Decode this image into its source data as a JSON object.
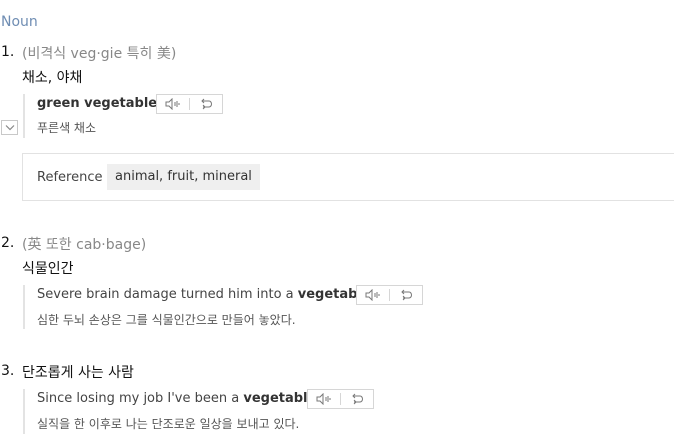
{
  "part_of_speech": "Noun",
  "senses": [
    {
      "number": "1.",
      "note": "(비격식 veg·gie 특히 美)",
      "meaning": "채소, 야채",
      "example": {
        "pre": "",
        "bold": "green vegetables",
        "post": "",
        "translation": "푸른색 채소"
      },
      "reference": {
        "label": "Reference",
        "items": "animal, fruit, mineral"
      }
    },
    {
      "number": "2.",
      "note": "(英 또한 cab·bage)",
      "meaning": "식물인간",
      "example": {
        "pre": "Severe brain damage turned him into a ",
        "bold": "vegetable",
        "post": ".",
        "translation": "심한 두뇌 손상은 그를 식물인간으로 만들어 놓았다."
      }
    },
    {
      "number": "3.",
      "meaning": "단조롭게 사는 사람",
      "example": {
        "pre": "Since losing my job I've been a ",
        "bold": "vegetable",
        "post": ".",
        "translation": "실직을 한 이후로 나는 단조로운 일상을 보내고 있다."
      }
    }
  ],
  "icons": {
    "audio": "speaker-icon",
    "repeat": "repeat-icon",
    "expand": "chevron-down-icon"
  },
  "colors": {
    "pos_label": "#6f8db3",
    "example_bar": "#e3e3e3",
    "chip_bg": "#efefef"
  }
}
